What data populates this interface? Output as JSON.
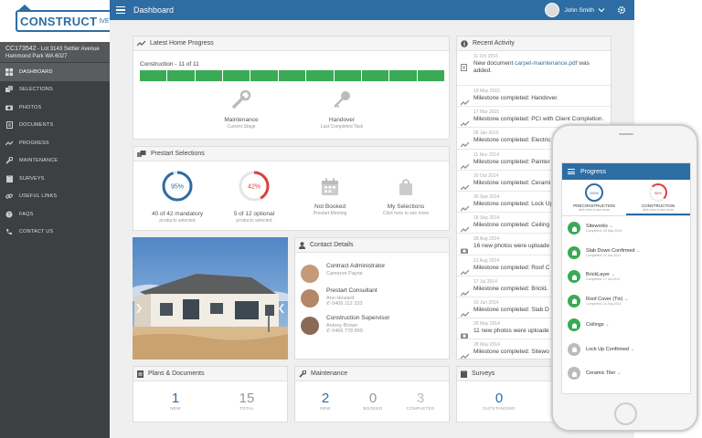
{
  "sidebar": {
    "logo_text": "CONSTRUCT",
    "logo_suffix": "IVE",
    "job_id": "CC173542",
    "job_address_line1": " - Lot 3143 Settler Avenue",
    "job_address_line2": "Hammond Park WA 6027",
    "items": [
      {
        "label": "DASHBOARD",
        "icon": "dashboard-icon"
      },
      {
        "label": "SELECTIONS",
        "icon": "selections-icon"
      },
      {
        "label": "PHOTOS",
        "icon": "camera-icon"
      },
      {
        "label": "DOCUMENTS",
        "icon": "document-icon"
      },
      {
        "label": "PROGRESS",
        "icon": "progress-icon"
      },
      {
        "label": "MAINTENANCE",
        "icon": "wrench-icon"
      },
      {
        "label": "SURVEYS",
        "icon": "survey-icon"
      },
      {
        "label": "USEFUL LINKS",
        "icon": "link-icon"
      },
      {
        "label": "FAQS",
        "icon": "help-icon"
      },
      {
        "label": "CONTACT US",
        "icon": "phone-icon"
      }
    ]
  },
  "header": {
    "title": "Dashboard",
    "user_name": "John Smith"
  },
  "home_progress": {
    "title": "Latest Home Progress",
    "label": "Construction - 11 of 11",
    "segments_complete": 11,
    "segments_total": 11,
    "current_stage": "Maintenance",
    "current_stage_caption": "Current Stage",
    "last_task": "Handover",
    "last_task_caption": "Last Completed Task"
  },
  "prestart": {
    "title": "Prestart Selections",
    "mandatory_percent": "95%",
    "mandatory_fraction": 0.95,
    "mandatory_label": "40 of 42 mandatory",
    "mandatory_sub": "products selected",
    "optional_percent": "42%",
    "optional_fraction": 0.42,
    "optional_label": "5 of 12 optional",
    "optional_sub": "products selected",
    "meeting_label": "Not Booked",
    "meeting_sub": "Prestart Meeting",
    "my_selections_label": "My Selections",
    "my_selections_sub": "Click here to see more"
  },
  "contacts": {
    "title": "Contact Details",
    "items": [
      {
        "role": "Contract Administrator",
        "name": "Cameron Payne",
        "phone": ""
      },
      {
        "role": "Prestart Consultant",
        "name": "Ann Howard",
        "phone": "0406 112 233"
      },
      {
        "role": "Construction Supervisor",
        "name": "Antony Brown",
        "phone": "0406 778 899"
      }
    ]
  },
  "plans": {
    "title": "Plans & Documents",
    "new_value": "1",
    "new_label": "NEW",
    "total_value": "15",
    "total_label": "TOTAL"
  },
  "maintenance": {
    "title": "Maintenance",
    "new_value": "2",
    "new_label": "NEW",
    "booked_value": "0",
    "booked_label": "BOOKED",
    "completed_value": "3",
    "completed_label": "COMPLETED"
  },
  "surveys": {
    "title": "Surveys",
    "outstanding_value": "0",
    "outstanding_label": "OUTSTANDING"
  },
  "activity": {
    "title": "Recent Activity",
    "items": [
      {
        "date": "11 Oct 2016",
        "text": "New document ",
        "link": "carpet-maintenance.pdf",
        "text2": " was",
        "text3": "added.",
        "icon": "document-icon"
      },
      {
        "date": "19 May 2015",
        "text": "Milestone completed: Handover.",
        "icon": "progress-icon"
      },
      {
        "date": "17 Mar 2015",
        "text": "Milestone completed: PCI with Client Completion.",
        "icon": "progress-icon"
      },
      {
        "date": "06 Jan 2015",
        "text": "Milestone completed: Electric",
        "icon": "progress-icon"
      },
      {
        "date": "11 Nov 2014",
        "text": "Milestone completed: Painter",
        "icon": "progress-icon"
      },
      {
        "date": "20 Oct 2014",
        "text": "Milestone completed: Cerami",
        "icon": "progress-icon"
      },
      {
        "date": "30 Sep 2014",
        "text": "Milestone completed: Lock Up",
        "icon": "progress-icon"
      },
      {
        "date": "18 Sep 2014",
        "text": "Milestone completed: Ceiling",
        "icon": "progress-icon"
      },
      {
        "date": "28 Aug 2014",
        "text": "16 new photos were uploade",
        "icon": "camera-icon"
      },
      {
        "date": "21 Aug 2014",
        "text": "Milestone completed: Roof C",
        "icon": "progress-icon"
      },
      {
        "date": "17 Jul 2014",
        "text": "Milestone completed: BrickL",
        "icon": "progress-icon"
      },
      {
        "date": "10 Jun 2014",
        "text": "Milestone completed: Slab D",
        "icon": "progress-icon"
      },
      {
        "date": "28 May 2014",
        "text": "11 new photos were uploade",
        "icon": "camera-icon"
      },
      {
        "date": "28 May 2014",
        "text": "Milestone completed: Sitewo",
        "icon": "progress-icon"
      }
    ]
  },
  "phone": {
    "title": "Progress",
    "tab1_percent": "100%",
    "tab1_label": "PRECONSTRUCTION",
    "tab1_sub": "click here to see more",
    "tab2_percent": "58%",
    "tab2_label": "CONSTRUCTION",
    "tab2_sub": "click here to see more",
    "items": [
      {
        "name": "Siteworks",
        "date": "Completed: 28 May 2014",
        "done": true
      },
      {
        "name": "Slab Down Confirmed",
        "date": "Completed: 10 Jun 2014",
        "done": true
      },
      {
        "name": "BrickLayer",
        "date": "Completed: 17 Jul 2014",
        "done": true
      },
      {
        "name": "Roof Cover (Tin)",
        "date": "Completed: 21 Aug 2014",
        "done": true
      },
      {
        "name": "Ceilings",
        "date": "",
        "done": true
      },
      {
        "name": "Lock Up Confirmed",
        "date": "",
        "done": false
      },
      {
        "name": "Ceramic Tiler",
        "date": "",
        "done": false
      }
    ]
  }
}
